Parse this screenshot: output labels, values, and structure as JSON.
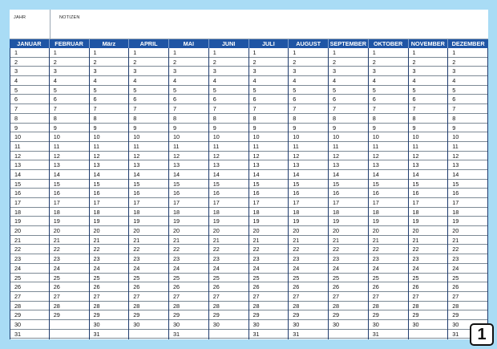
{
  "header": {
    "year_label": "JAHR",
    "notes_label": "NOTIZEN"
  },
  "months": [
    {
      "name": "JANUAR",
      "days": 31
    },
    {
      "name": "FEBRUAR",
      "days": 29
    },
    {
      "name": "März",
      "days": 31
    },
    {
      "name": "APRIL",
      "days": 30
    },
    {
      "name": "MAI",
      "days": 31
    },
    {
      "name": "JUNI",
      "days": 30
    },
    {
      "name": "JULI",
      "days": 31
    },
    {
      "name": "AUGUST",
      "days": 31
    },
    {
      "name": "SEPTEMBER",
      "days": 30
    },
    {
      "name": "OKTOBER",
      "days": 31
    },
    {
      "name": "NOVEMBER",
      "days": 30
    },
    {
      "name": "DEZEMBER",
      "days": 31
    }
  ],
  "page_number": "1",
  "colors": {
    "background": "#a9dcf5",
    "month_bar": "#1f55a5"
  }
}
